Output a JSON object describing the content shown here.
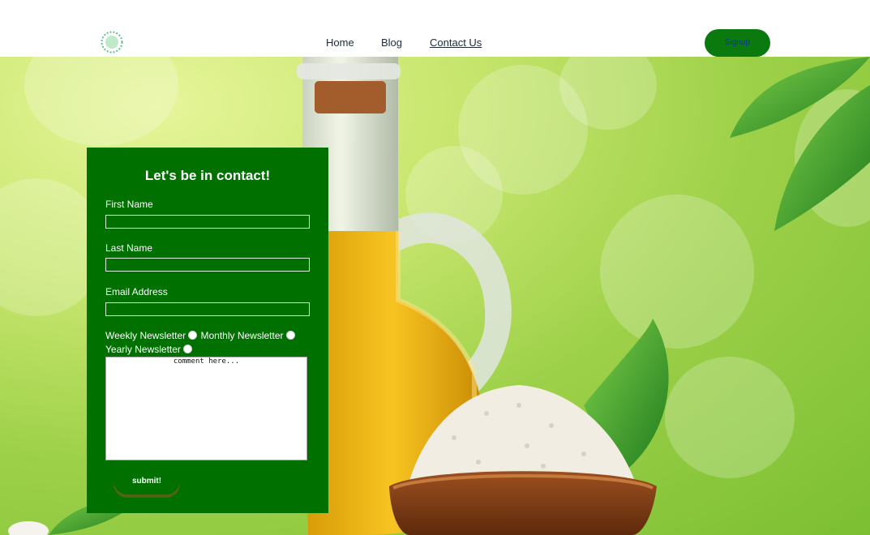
{
  "nav": {
    "home": "Home",
    "blog": "Blog",
    "contact": "Contact Us",
    "signup": "Signup"
  },
  "form": {
    "title": "Let's be in contact!",
    "first_name_label": "First Name",
    "first_name_value": "",
    "last_name_label": "Last Name",
    "last_name_value": "",
    "email_label": "Email Address",
    "email_value": "",
    "radio_options": [
      "Weekly Newsletter",
      "Monthly Newsletter",
      "Yearly Newsletter"
    ],
    "comment_placeholder": "comment here...",
    "submit_label": "submit!"
  },
  "colors": {
    "brand_green": "#007000",
    "signup_text": "#0e3b8a",
    "nav_text": "#1d2a3a"
  },
  "icons": {
    "logo": "leaf-circle-logo-icon"
  }
}
